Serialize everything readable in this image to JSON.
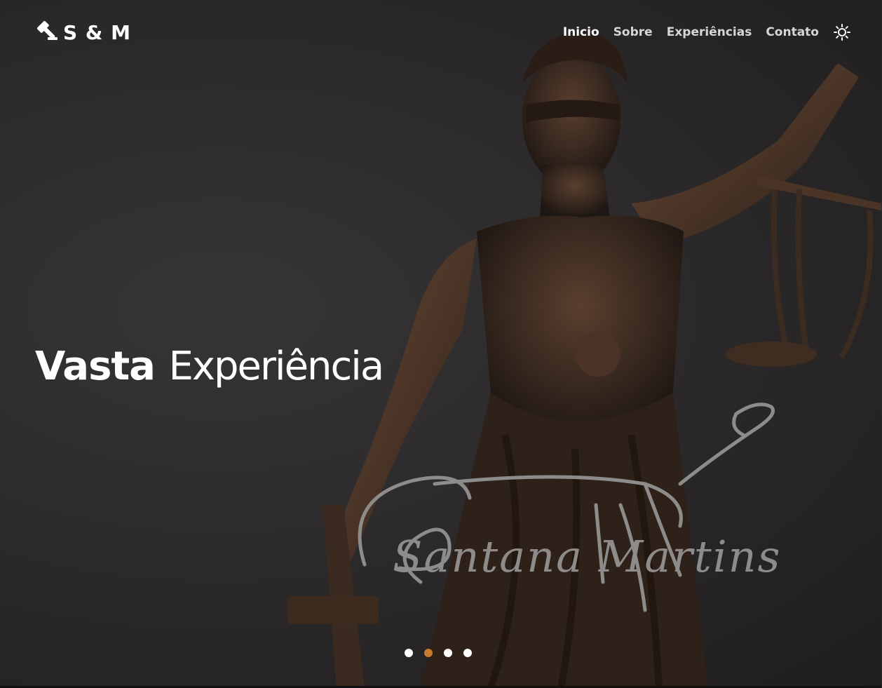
{
  "brand": {
    "name": "S & M",
    "icon": "gavel-icon"
  },
  "nav": {
    "items": [
      {
        "label": "Inicio",
        "active": true
      },
      {
        "label": "Sobre",
        "active": false
      },
      {
        "label": "Experiências",
        "active": false
      },
      {
        "label": "Contato",
        "active": false
      }
    ],
    "theme_icon": "sun-icon"
  },
  "hero": {
    "headline_bold": "Vasta",
    "headline_light": "Experiência",
    "signature": "Santana Martins"
  },
  "carousel": {
    "slides": 4,
    "active_index": 1
  },
  "colors": {
    "accent": "#c87a2e",
    "background": "#2a2829",
    "signature": "#8e8c8b"
  }
}
